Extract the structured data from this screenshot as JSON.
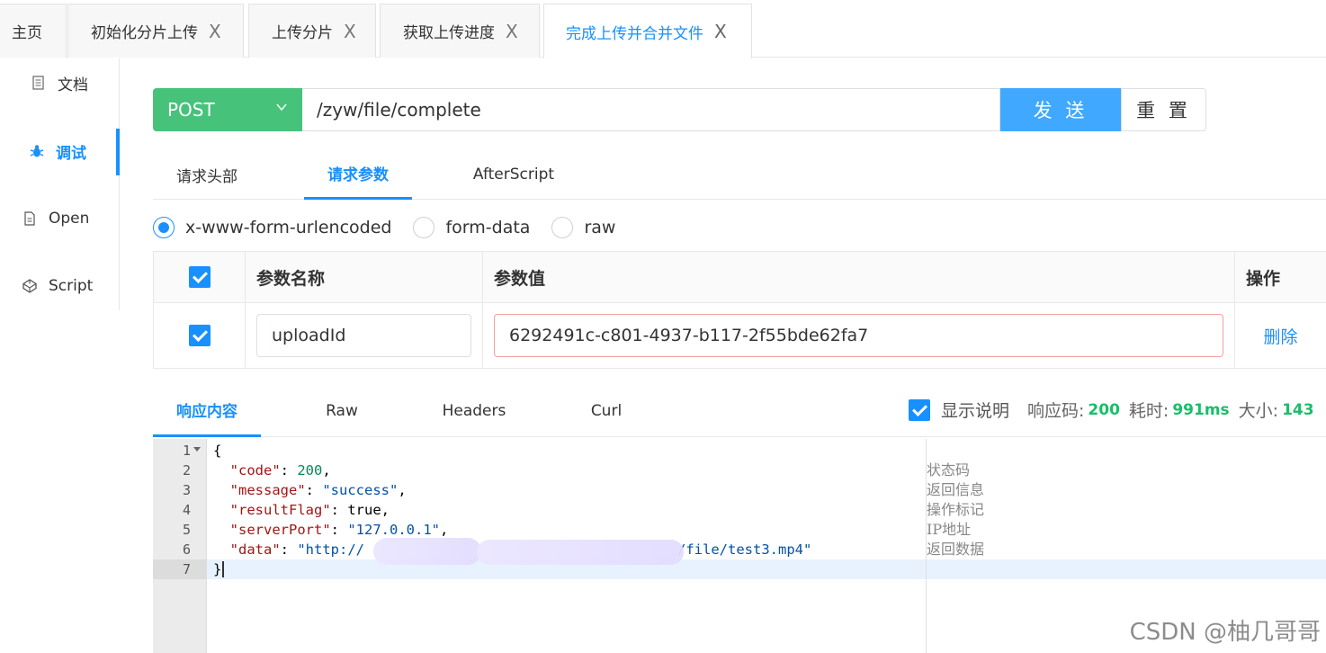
{
  "tabs": [
    {
      "label": "主页",
      "closable": false,
      "active": false
    },
    {
      "label": "初始化分片上传",
      "closable": true,
      "active": false
    },
    {
      "label": "上传分片",
      "closable": true,
      "active": false
    },
    {
      "label": "获取上传进度",
      "closable": true,
      "active": false
    },
    {
      "label": "完成上传并合并文件",
      "closable": true,
      "active": true
    }
  ],
  "close_glyph": "X",
  "sidebar": {
    "items": [
      {
        "label": "文档",
        "icon": "document-icon"
      },
      {
        "label": "调试",
        "icon": "bug-icon",
        "active": true
      },
      {
        "label": "Open",
        "icon": "file-icon"
      },
      {
        "label": "Script",
        "icon": "codepen-icon"
      }
    ]
  },
  "request": {
    "method": "POST",
    "url": "/zyw/file/complete",
    "send_label": "发 送",
    "reset_label": "重 置"
  },
  "param_tabs": [
    {
      "label": "请求头部"
    },
    {
      "label": "请求参数",
      "active": true
    },
    {
      "label": "AfterScript"
    }
  ],
  "body_types": [
    {
      "label": "x-www-form-urlencoded",
      "selected": true
    },
    {
      "label": "form-data"
    },
    {
      "label": "raw"
    }
  ],
  "params_table": {
    "headers": [
      "参数名称",
      "参数值",
      "操作"
    ],
    "rows": [
      {
        "checked": true,
        "name": "uploadId",
        "value": "6292491c-c801-4937-b117-2f55bde62fa7",
        "action": "删除"
      }
    ]
  },
  "response_tabs": [
    {
      "label": "响应内容",
      "active": true
    },
    {
      "label": "Raw"
    },
    {
      "label": "Headers"
    },
    {
      "label": "Curl"
    }
  ],
  "response_info": {
    "show_desc_label": "显示说明",
    "show_desc_checked": true,
    "status_label": "响应码:",
    "status_value": "200",
    "time_label": "耗时:",
    "time_value": "991ms",
    "size_label": "大小:",
    "size_value": "143"
  },
  "response_code": {
    "line_numbers": [
      "1",
      "2",
      "3",
      "4",
      "5",
      "6",
      "7"
    ],
    "lines": {
      "open": "{",
      "code_key": "\"code\"",
      "code_val": "200",
      "message_key": "\"message\"",
      "message_val": "\"success\"",
      "result_key": "\"resultFlag\"",
      "result_val": "true",
      "port_key": "\"serverPort\"",
      "port_val": "\"127.0.0.1\"",
      "data_key": "\"data\"",
      "data_val_start": "\"http://",
      "data_val_end": "/file/test3.mp4\"",
      "close": "}"
    },
    "comments": [
      "状态码",
      "返回信息",
      "操作标记",
      "IP地址",
      "返回数据"
    ]
  },
  "watermark": "CSDN @柚几哥哥",
  "colors": {
    "accent": "#1890ff",
    "method_bg": "#47c27a",
    "send_bg": "#40a9ff",
    "status_green": "#19be6b"
  }
}
